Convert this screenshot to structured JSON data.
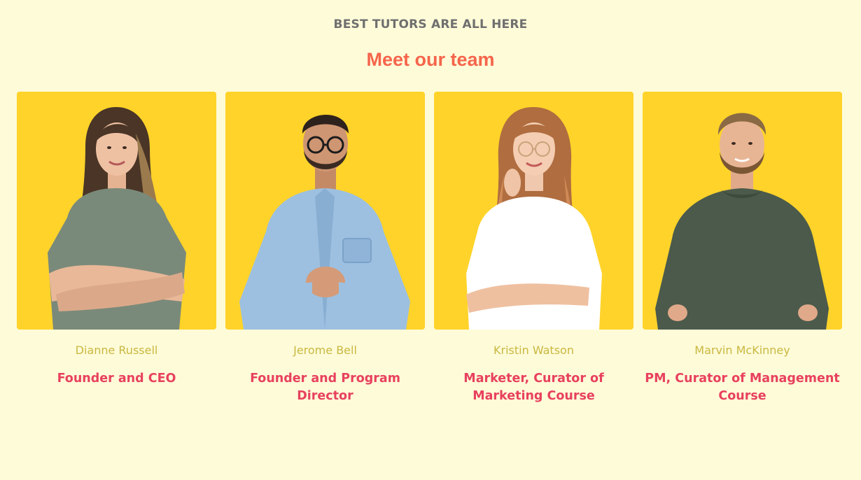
{
  "section": {
    "eyebrow": "BEST TUTORS ARE ALL HERE",
    "title": "Meet our team"
  },
  "colors": {
    "background": "#fefbd9",
    "card_background": "#ffd32a",
    "eyebrow": "#6f6f6f",
    "title": "#f5654b",
    "name": "#c9b840",
    "role": "#e8415e"
  },
  "team": [
    {
      "name": "Dianne Russell",
      "role": "Founder and CEO",
      "photo_icon": "woman-crossed-arms-portrait"
    },
    {
      "name": "Jerome Bell",
      "role": "Founder and Program Director",
      "photo_icon": "man-glasses-portrait"
    },
    {
      "name": "Kristin Watson",
      "role": "Marketer, Curator of Marketing Course",
      "photo_icon": "woman-glasses-portrait"
    },
    {
      "name": "Marvin McKinney",
      "role": "PM, Curator of Management Course",
      "photo_icon": "man-beard-portrait"
    }
  ]
}
